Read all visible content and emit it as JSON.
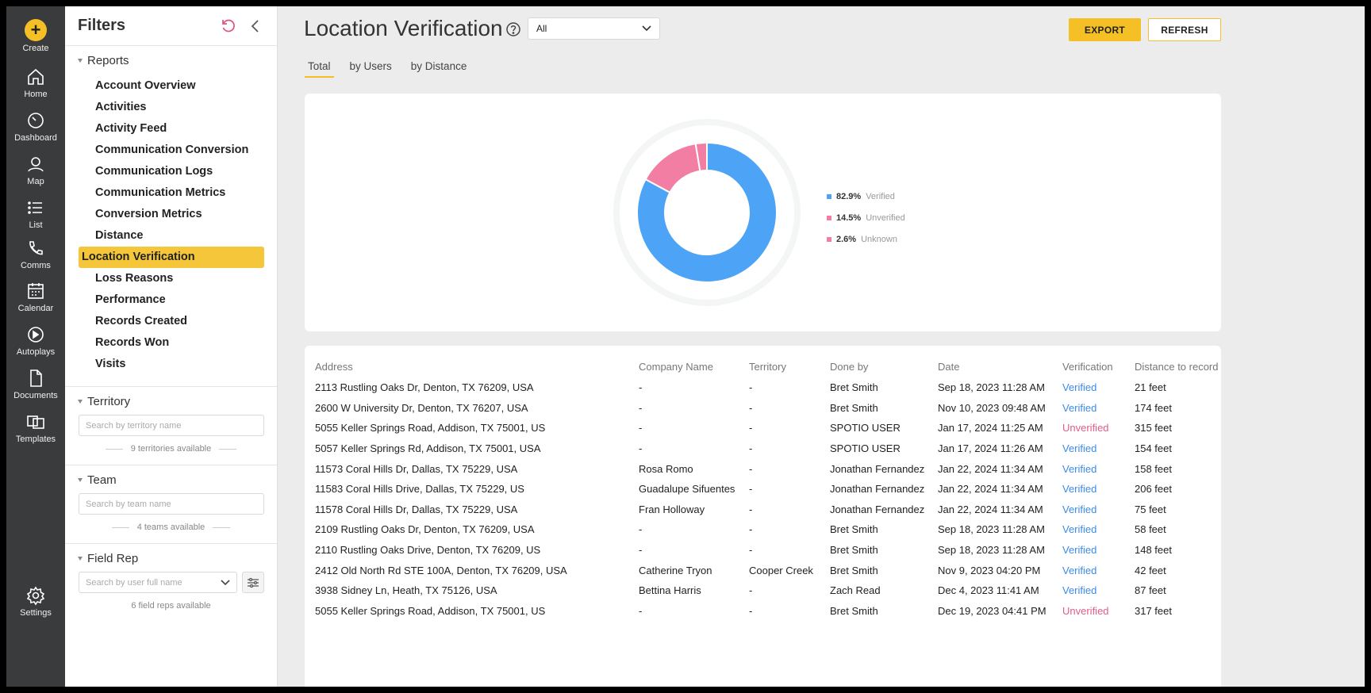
{
  "nav": {
    "create": "Create",
    "items": [
      "Home",
      "Dashboard",
      "Map",
      "List",
      "Comms",
      "Calendar",
      "Autoplays",
      "Documents",
      "Templates"
    ],
    "settings": "Settings",
    "accent": "#f5c026"
  },
  "filters": {
    "title": "Filters",
    "reports_label": "Reports",
    "reports": [
      "Account Overview",
      "Activities",
      "Activity Feed",
      "Communication Conversion",
      "Communication Logs",
      "Communication Metrics",
      "Conversion Metrics",
      "Distance",
      "Location Verification",
      "Loss Reasons",
      "Performance",
      "Records Created",
      "Records Won",
      "Visits"
    ],
    "active_report": "Location Verification",
    "territory": {
      "label": "Territory",
      "placeholder": "Search by territory name",
      "available": "9 territories available"
    },
    "team": {
      "label": "Team",
      "placeholder": "Search by team name",
      "available": "4 teams available"
    },
    "field_rep": {
      "label": "Field Rep",
      "placeholder": "Search by user full name",
      "available": "6 field reps available"
    }
  },
  "main": {
    "title": "Location Verification",
    "select_value": "All",
    "export_label": "EXPORT",
    "refresh_label": "REFRESH",
    "tabs": [
      "Total",
      "by Users",
      "by Distance"
    ],
    "active_tab": "Total"
  },
  "chart_data": {
    "type": "pie",
    "donut": true,
    "categories": [
      "Verified",
      "Unverified",
      "Unknown"
    ],
    "values": [
      82.9,
      14.5,
      2.6
    ],
    "labels": [
      "82.9%",
      "14.5%",
      "2.6%"
    ],
    "colors": [
      "#4da3f5",
      "#f27ea4",
      "#f27ea4"
    ],
    "legend": "right"
  },
  "table": {
    "headers": [
      "Address",
      "Company Name",
      "Territory",
      "Done by",
      "Date",
      "Verification",
      "Distance to record"
    ],
    "rows": [
      [
        "2113 Rustling Oaks Dr, Denton, TX 76209, USA",
        "-",
        "-",
        "Bret Smith",
        "Sep 18, 2023 11:28 AM",
        "Verified",
        "21 feet"
      ],
      [
        "2600 W University Dr, Denton, TX 76207, USA",
        "-",
        "-",
        "Bret Smith",
        "Nov 10, 2023 09:48 AM",
        "Verified",
        "174 feet"
      ],
      [
        "5055 Keller Springs Road, Addison, TX 75001, US",
        "-",
        "-",
        "SPOTIO USER",
        "Jan 17, 2024 11:25 AM",
        "Unverified",
        "315 feet"
      ],
      [
        "5057 Keller Springs Rd, Addison, TX 75001, USA",
        "-",
        "-",
        "SPOTIO USER",
        "Jan 17, 2024 11:26 AM",
        "Verified",
        "154 feet"
      ],
      [
        "11573 Coral Hills Dr, Dallas, TX 75229, USA",
        "Rosa Romo",
        "-",
        "Jonathan Fernandez",
        "Jan 22, 2024 11:34 AM",
        "Verified",
        "158 feet"
      ],
      [
        "11583 Coral Hills Drive, Dallas, TX 75229, US",
        "Guadalupe Sifuentes",
        "-",
        "Jonathan Fernandez",
        "Jan 22, 2024 11:34 AM",
        "Verified",
        "206 feet"
      ],
      [
        "11578 Coral Hills Dr, Dallas, TX 75229, USA",
        "Fran Holloway",
        "-",
        "Jonathan Fernandez",
        "Jan 22, 2024 11:34 AM",
        "Verified",
        "75 feet"
      ],
      [
        "2109 Rustling Oaks Dr, Denton, TX 76209, USA",
        "-",
        "-",
        "Bret Smith",
        "Sep 18, 2023 11:28 AM",
        "Verified",
        "58 feet"
      ],
      [
        "2110 Rustling Oaks Drive, Denton, TX 76209, US",
        "-",
        "-",
        "Bret Smith",
        "Sep 18, 2023 11:28 AM",
        "Verified",
        "148 feet"
      ],
      [
        "2412 Old North Rd STE 100A, Denton, TX 76209, USA",
        "Catherine Tryon",
        "Cooper Creek",
        "Bret Smith",
        "Nov 9, 2023 04:20 PM",
        "Verified",
        "42 feet"
      ],
      [
        "3938 Sidney Ln, Heath, TX 75126, USA",
        "Bettina Harris",
        "-",
        "Zach Read",
        "Dec 4, 2023 11:41 AM",
        "Verified",
        "87 feet"
      ],
      [
        "5055 Keller Springs Road, Addison, TX 75001, US",
        "-",
        "-",
        "Bret Smith",
        "Dec 19, 2023 04:41 PM",
        "Unverified",
        "317 feet"
      ]
    ]
  }
}
